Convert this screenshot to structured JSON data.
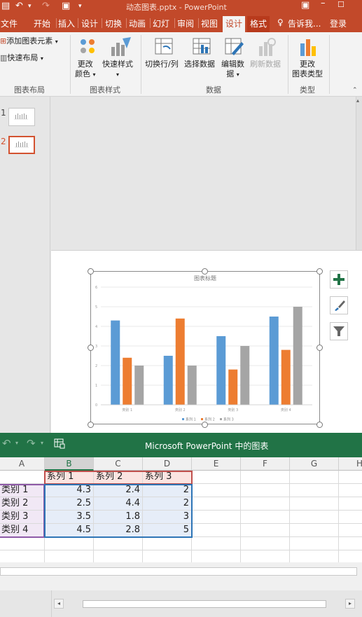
{
  "titlebar": {
    "title": "动态图表.pptx - PowerPoint"
  },
  "tabs": [
    {
      "label": "文件"
    },
    {
      "label": "开始"
    },
    {
      "label": "插入"
    },
    {
      "label": "设计"
    },
    {
      "label": "切换"
    },
    {
      "label": "动画"
    },
    {
      "label": "幻灯"
    },
    {
      "label": "审阅"
    },
    {
      "label": "视图"
    },
    {
      "label": "设计"
    },
    {
      "label": "格式"
    }
  ],
  "tell_me": "告诉我...",
  "login": "登录",
  "ribbon": {
    "add_element": "添加图表元素",
    "quick_layout": "快速布局",
    "group_layout": "图表布局",
    "change_color_1": "更改",
    "change_color_2": "颜色",
    "quick_style": "快速样式",
    "group_style": "图表样式",
    "switch_row_col": "切换行/列",
    "select_data": "选择数据",
    "edit_data_1": "编辑数",
    "edit_data_2": "据",
    "refresh_data": "刷新数据",
    "group_data": "数据",
    "change_type_1": "更改",
    "change_type_2": "图表类型",
    "group_type": "类型"
  },
  "thumbs": [
    {
      "num": "1"
    },
    {
      "num": "2"
    }
  ],
  "chart_data": {
    "type": "bar",
    "title": "图表标题",
    "categories": [
      "类别 1",
      "类别 2",
      "类别 3",
      "类别 4"
    ],
    "series": [
      {
        "name": "系列 1",
        "values": [
          4.3,
          2.5,
          3.5,
          4.5
        ],
        "color": "#5b9bd5"
      },
      {
        "name": "系列 2",
        "values": [
          2.4,
          4.4,
          1.8,
          2.8
        ],
        "color": "#ed7d31"
      },
      {
        "name": "系列 3",
        "values": [
          2,
          2,
          3,
          5
        ],
        "color": "#a5a5a5"
      }
    ],
    "ylim": [
      0,
      6
    ],
    "yticks": [
      "0",
      "1",
      "2",
      "3",
      "4",
      "5",
      "6"
    ],
    "grid": true,
    "legend": "bottom"
  },
  "excel": {
    "title": "Microsoft PowerPoint 中的图表",
    "columns": [
      "A",
      "B",
      "C",
      "D",
      "E",
      "F",
      "G",
      "H"
    ],
    "header_row": [
      "",
      "系列 1",
      "系列 2",
      "系列 3"
    ],
    "rows": [
      [
        "类别 1",
        "4.3",
        "2.4",
        "2"
      ],
      [
        "类别 2",
        "2.5",
        "4.4",
        "2"
      ],
      [
        "类别 3",
        "3.5",
        "1.8",
        "3"
      ],
      [
        "类别 4",
        "4.5",
        "2.8",
        "5"
      ]
    ]
  },
  "colors": {
    "accent": "#c2492a",
    "excel_green": "#217346",
    "selection": "#d35230"
  }
}
